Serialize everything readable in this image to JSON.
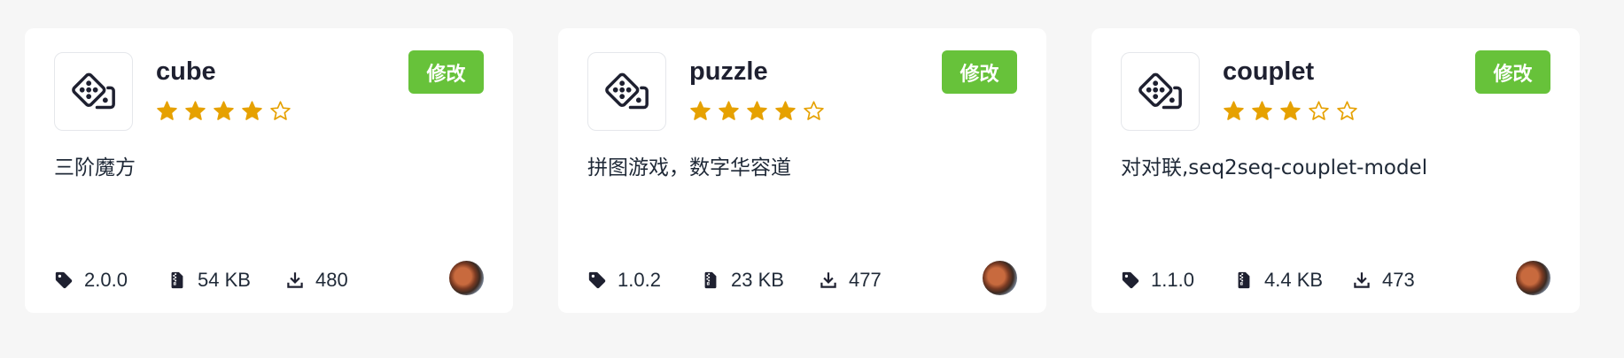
{
  "edit_label": "修改",
  "colors": {
    "accent": "#67c23a",
    "star": "#e6a100",
    "background": "#f6f6f6",
    "card": "#ffffff"
  },
  "cards": [
    {
      "name": "cube",
      "rating": 4,
      "max_rating": 5,
      "description": "三阶魔方",
      "version": "2.0.0",
      "size": "54 KB",
      "downloads": "480",
      "icon": "dice-icon"
    },
    {
      "name": "puzzle",
      "rating": 4,
      "max_rating": 5,
      "description": "拼图游戏，数字华容道",
      "version": "1.0.2",
      "size": "23 KB",
      "downloads": "477",
      "icon": "dice-icon"
    },
    {
      "name": "couplet",
      "rating": 3,
      "max_rating": 5,
      "description": "对对联,seq2seq-couplet-model",
      "version": "1.1.0",
      "size": "4.4 KB",
      "downloads": "473",
      "icon": "dice-icon"
    }
  ]
}
